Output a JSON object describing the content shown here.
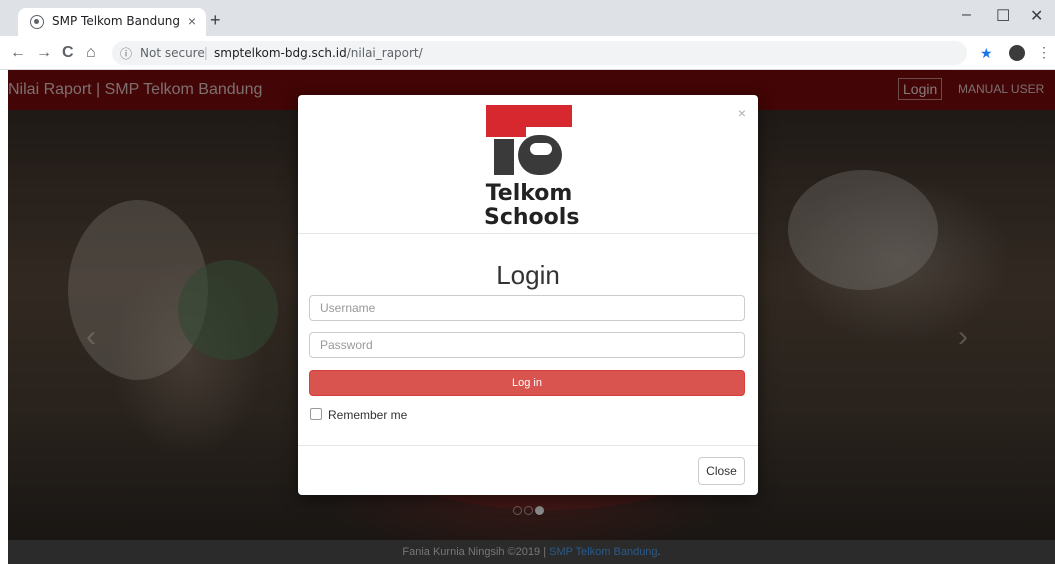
{
  "browser": {
    "tab_title": "SMP Telkom Bandung",
    "tab_close": "×",
    "new_tab": "+",
    "window_minimize": "–",
    "window_maximize": "☐",
    "window_close": "✕",
    "nav_back": "←",
    "nav_forward": "→",
    "nav_reload": "C",
    "nav_home": "⌂",
    "security_label": "Not secure",
    "url_host": "smptelkom-bdg.sch.id",
    "url_path": "/nilai_raport/",
    "bookmark_icon": "★",
    "menu_icon": "⋮"
  },
  "navbar": {
    "brand": "Nilai Raport | SMP Telkom Bandung",
    "login": "Login",
    "manual": "MANUAL USER"
  },
  "carousel": {
    "prev_arrow": "‹",
    "next_arrow": "›",
    "slide_count": 3,
    "active_slide": 3
  },
  "modal": {
    "close_x": "×",
    "logo_line1": "Telkom",
    "logo_line2": "Schools",
    "title": "Login",
    "username_placeholder": "Username",
    "password_placeholder": "Password",
    "login_button": "Log in",
    "remember_label": "Remember me",
    "close_button": "Close"
  },
  "footer": {
    "text": "Fania Kurnia Ningsih ©2019 | ",
    "link": "SMP Telkom Bandung",
    "suffix": "."
  },
  "colors": {
    "navbar": "#7b0a0a",
    "login_button": "#d9534f",
    "logo_red": "#d7272f",
    "footer": "#2b2b2b"
  }
}
